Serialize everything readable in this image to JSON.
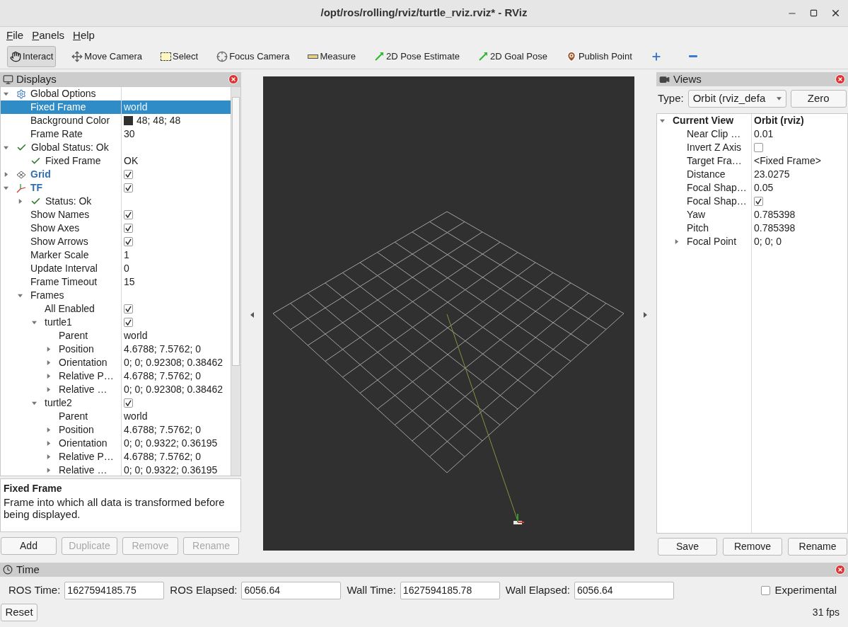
{
  "window": {
    "title": "/opt/ros/rolling/rviz/turtle_rviz.rviz* - RViz"
  },
  "menu": [
    "File",
    "Panels",
    "Help"
  ],
  "tools": [
    {
      "label": "Interact",
      "kind": "interact",
      "selected": true
    },
    {
      "label": "Move Camera",
      "kind": "move",
      "selected": false
    },
    {
      "label": "Select",
      "kind": "select",
      "selected": false
    },
    {
      "label": "Focus Camera",
      "kind": "focus",
      "selected": false
    },
    {
      "label": "Measure",
      "kind": "measure",
      "selected": false
    },
    {
      "label": "2D Pose Estimate",
      "kind": "pose",
      "selected": false
    },
    {
      "label": "2D Goal Pose",
      "kind": "goal",
      "selected": false
    },
    {
      "label": "Publish Point",
      "kind": "point",
      "selected": false
    },
    {
      "kind": "add",
      "selected": false
    },
    {
      "kind": "remove",
      "selected": false
    }
  ],
  "displays": {
    "title": "Displays",
    "tree": [
      {
        "label": "Global Options",
        "kind": "options",
        "expanded": true,
        "selected": false,
        "children": [
          {
            "label": "Fixed Frame",
            "value": "world",
            "selected": true
          },
          {
            "label": "Background Color",
            "value": "48; 48; 48",
            "color": "#303030",
            "selected": false
          },
          {
            "label": "Frame Rate",
            "value": "30",
            "selected": false
          }
        ]
      },
      {
        "label": "Global Status: Ok",
        "kind": "status",
        "expanded": true,
        "selected": false,
        "children": [
          {
            "label": "Fixed Frame",
            "value": "OK",
            "kind": "status",
            "selected": false
          }
        ]
      },
      {
        "label": "Grid",
        "kind": "grid",
        "expanded": false,
        "checked": true,
        "selected": false
      },
      {
        "label": "TF",
        "kind": "tf",
        "expanded": true,
        "checked": true,
        "selected": false,
        "children": [
          {
            "label": "Status: Ok",
            "kind": "status",
            "expanded": false,
            "selected": false
          },
          {
            "label": "Show Names",
            "checked": true,
            "selected": false
          },
          {
            "label": "Show Axes",
            "checked": true,
            "selected": false
          },
          {
            "label": "Show Arrows",
            "checked": true,
            "selected": false
          },
          {
            "label": "Marker Scale",
            "value": "1",
            "selected": false
          },
          {
            "label": "Update Interval",
            "value": "0",
            "selected": false
          },
          {
            "label": "Frame Timeout",
            "value": "15",
            "selected": false
          },
          {
            "label": "Frames",
            "expanded": true,
            "selected": false,
            "children": [
              {
                "label": "All Enabled",
                "checked": true,
                "selected": false
              },
              {
                "label": "turtle1",
                "checked": true,
                "expanded": true,
                "selected": false,
                "children": [
                  {
                    "label": "Parent",
                    "value": "world",
                    "selected": false
                  },
                  {
                    "label": "Position",
                    "value": "4.6788; 7.5762; 0",
                    "expanded": false,
                    "selected": false
                  },
                  {
                    "label": "Orientation",
                    "value": "0; 0; 0.92308; 0.38462",
                    "expanded": false,
                    "selected": false
                  },
                  {
                    "label": "Relative P…",
                    "value": "4.6788; 7.5762; 0",
                    "expanded": false,
                    "selected": false
                  },
                  {
                    "label": "Relative …",
                    "value": "0; 0; 0.92308; 0.38462",
                    "expanded": false,
                    "selected": false
                  }
                ]
              },
              {
                "label": "turtle2",
                "checked": true,
                "expanded": true,
                "selected": false,
                "children": [
                  {
                    "label": "Parent",
                    "value": "world",
                    "selected": false
                  },
                  {
                    "label": "Position",
                    "value": "4.6788; 7.5762; 0",
                    "expanded": false,
                    "selected": false
                  },
                  {
                    "label": "Orientation",
                    "value": "0; 0; 0.9322; 0.36195",
                    "expanded": false,
                    "selected": false
                  },
                  {
                    "label": "Relative P…",
                    "value": "4.6788; 7.5762; 0",
                    "expanded": false,
                    "selected": false
                  },
                  {
                    "label": "Relative …",
                    "value": "0; 0; 0.9322; 0.36195",
                    "expanded": false,
                    "selected": false
                  }
                ]
              }
            ]
          }
        ]
      }
    ],
    "description": {
      "title": "Fixed Frame",
      "text": "Frame into which all data is transformed before being displayed."
    },
    "buttons": [
      {
        "label": "Add",
        "disabled": false
      },
      {
        "label": "Duplicate",
        "disabled": true
      },
      {
        "label": "Remove",
        "disabled": true
      },
      {
        "label": "Rename",
        "disabled": true
      }
    ]
  },
  "views": {
    "title": "Views",
    "type_label": "Type:",
    "type_value": "Orbit (rviz_defa",
    "zero_button": "Zero",
    "tree": [
      {
        "label": "Current View",
        "value": "Orbit (rviz)",
        "kind": "header",
        "expanded": true,
        "selected": false,
        "children": [
          {
            "label": "Near Clip …",
            "value": "0.01",
            "selected": false
          },
          {
            "label": "Invert Z Axis",
            "checked": false,
            "selected": false
          },
          {
            "label": "Target Fra…",
            "value": "<Fixed Frame>",
            "selected": false
          },
          {
            "label": "Distance",
            "value": "23.0275",
            "selected": false
          },
          {
            "label": "Focal Shap…",
            "value": "0.05",
            "selected": false
          },
          {
            "label": "Focal Shap…",
            "checked": true,
            "selected": false
          },
          {
            "label": "Yaw",
            "value": "0.785398",
            "selected": false
          },
          {
            "label": "Pitch",
            "value": "0.785398",
            "selected": false
          },
          {
            "label": "Focal Point",
            "value": "0; 0; 0",
            "expanded": false,
            "selected": false
          }
        ]
      }
    ],
    "buttons": [
      "Save",
      "Remove",
      "Rename"
    ]
  },
  "time": {
    "title": "Time",
    "fields": [
      {
        "label": "ROS Time:",
        "value": "1627594185.75"
      },
      {
        "label": "ROS Elapsed:",
        "value": "6056.64"
      },
      {
        "label": "Wall Time:",
        "value": "1627594185.78"
      },
      {
        "label": "Wall Elapsed:",
        "value": "6056.64"
      }
    ],
    "experimental": {
      "label": "Experimental",
      "checked": false
    },
    "reset_button": "Reset",
    "fps": "31 fps"
  }
}
